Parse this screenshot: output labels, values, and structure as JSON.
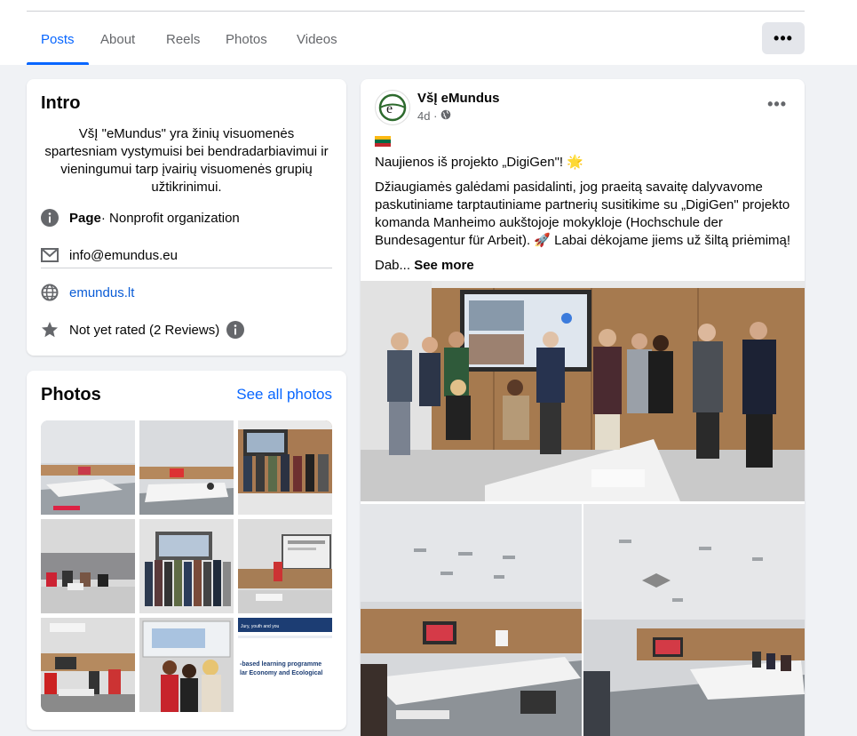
{
  "tabs": [
    "Posts",
    "About",
    "Reels",
    "Photos",
    "Videos"
  ],
  "more_label": "•••",
  "intro": {
    "title": "Intro",
    "bio": "VšĮ \"eMundus\" yra žinių visuomenės spartesniam vystymuisi bei bendradarbiavimui ir vieningumui tarp įvairių visuomenės grupių užtikrinimui.",
    "page_label": "Page",
    "page_category": " · Nonprofit organization",
    "email": "info@emundus.eu",
    "website": "emundus.lt",
    "rating": "Not yet rated (2 Reviews)"
  },
  "photos": {
    "title": "Photos",
    "see_all": "See all photos",
    "thumb9_lines": [
      "Jury, youth and you",
      "-based learning programme",
      "lar Economy and Ecological"
    ]
  },
  "post": {
    "author": "VšĮ eMundus",
    "time": "4d ·",
    "headline": "Naujienos iš projekto „DigiGen\"! 🌟",
    "body": "Džiaugiamės galėdami pasidalinti, jog praeitą savaitę dalyvavome paskutiniame tarptautiniame partnerių susitikime su „DigiGen\" projekto komanda Manheimo aukštojoje mokykloje (Hochschule der Bundesagentur für Arbeit). 🚀 Labai dėkojame jiems už šiltą priėmimą!",
    "truncated": "Dab...",
    "see_more": "See more"
  },
  "colors": {
    "accent": "#0866ff",
    "bg": "#f0f2f5",
    "muted": "#65676b"
  }
}
